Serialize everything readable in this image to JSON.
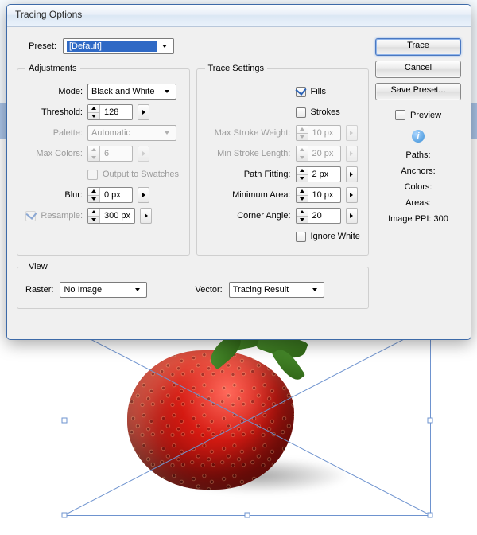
{
  "window": {
    "title": "Tracing Options"
  },
  "preset": {
    "label": "Preset:",
    "value": "[Default]"
  },
  "adjustments": {
    "legend": "Adjustments",
    "mode": {
      "label": "Mode:",
      "value": "Black and White"
    },
    "threshold": {
      "label": "Threshold:",
      "value": "128"
    },
    "palette": {
      "label": "Palette:",
      "value": "Automatic"
    },
    "maxColors": {
      "label": "Max Colors:",
      "value": "6"
    },
    "outputSwatches": {
      "label": "Output to Swatches",
      "checked": false
    },
    "blur": {
      "label": "Blur:",
      "value": "0 px"
    },
    "resample": {
      "label": "Resample:",
      "value": "300 px",
      "checked": true
    }
  },
  "traceSettings": {
    "legend": "Trace Settings",
    "fills": {
      "label": "Fills",
      "checked": true
    },
    "strokes": {
      "label": "Strokes",
      "checked": false
    },
    "maxStrokeWeight": {
      "label": "Max Stroke Weight:",
      "value": "10 px"
    },
    "minStrokeLength": {
      "label": "Min Stroke Length:",
      "value": "20 px"
    },
    "pathFitting": {
      "label": "Path Fitting:",
      "value": "2 px"
    },
    "minimumArea": {
      "label": "Minimum Area:",
      "value": "10 px"
    },
    "cornerAngle": {
      "label": "Corner Angle:",
      "value": "20"
    },
    "ignoreWhite": {
      "label": "Ignore White",
      "checked": false
    }
  },
  "view": {
    "legend": "View",
    "raster": {
      "label": "Raster:",
      "value": "No Image"
    },
    "vector": {
      "label": "Vector:",
      "value": "Tracing Result"
    }
  },
  "buttons": {
    "trace": "Trace",
    "cancel": "Cancel",
    "savePreset": "Save Preset..."
  },
  "preview": {
    "label": "Preview",
    "checked": false
  },
  "stats": {
    "paths": "Paths:",
    "anchors": "Anchors:",
    "colors": "Colors:",
    "areas": "Areas:",
    "imagePPI": "Image PPI: 300"
  }
}
